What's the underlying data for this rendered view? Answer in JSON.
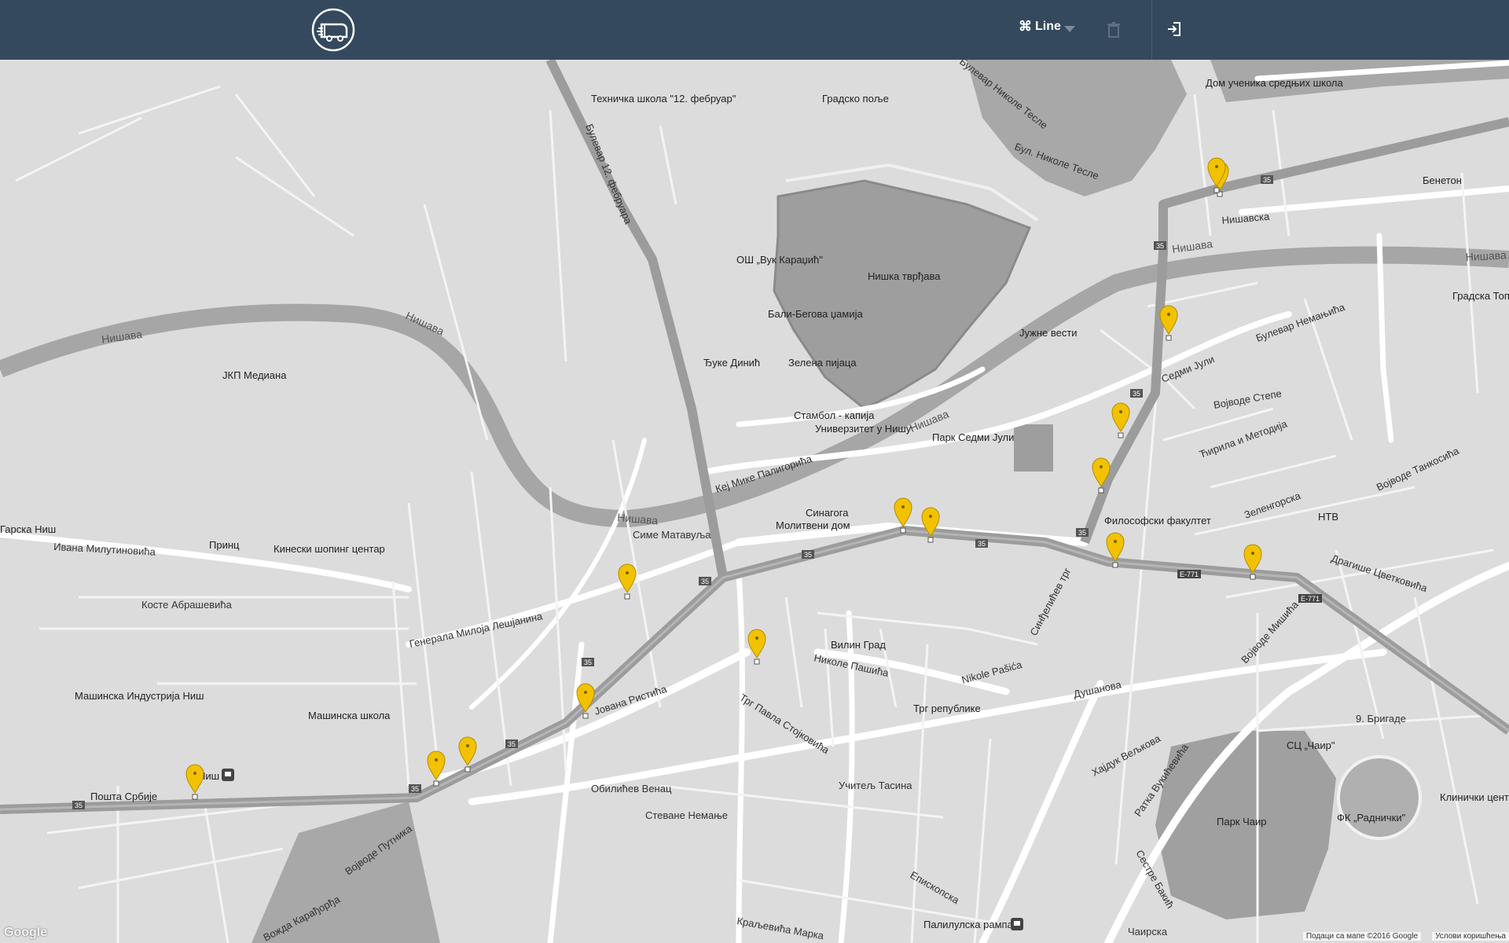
{
  "header": {
    "line_label": "Line",
    "line_icon": "command-icon",
    "trash_icon": "trash-icon",
    "login_icon": "sign-in-icon",
    "bg_color": "#34495e"
  },
  "map": {
    "rivers": [
      "Нишава",
      "Нишава",
      "Нишава",
      "Нишава",
      "Нишава",
      "Нишава"
    ],
    "places": [
      "Техничка школа \"12. фебруар\"",
      "Градско поље",
      "Дом ученика средњих школа",
      "Бенетон",
      "ОШ „Вук Караџић\"",
      "Нишка тврђава",
      "Бали-Бегова џамија",
      "Ђуке Динић",
      "Зелена пијаца",
      "Јужне вести",
      "Стамбол - капија",
      "Универзитет у Нишу",
      "Парк Седми Јули",
      "ЈКП Медиана",
      "Синагога",
      "Молитвени дом",
      "Философски факултет",
      "НТВ",
      "Принц",
      "Кинески шопинг центар",
      "Машинска Индустрија Ниш",
      "Машинска школа",
      "Вилин Град",
      "Трг републике",
      "Пошта Србије",
      "Ниш",
      "СЦ „Чаир\"",
      "Парк Чаир",
      "ФК „Раднички\"",
      "Клинички центар Н",
      "Палилулска рампа",
      "Градска Топл",
      "Гарска Ниш"
    ],
    "streets": [
      "Булевар 12. фебруара",
      "Булевар Николе Тесле",
      "Бул. Николе Тесле",
      "Нишавска",
      "Булевар Немањића",
      "Седми Јули",
      "Војводе Степе",
      "Ћирила и Методија",
      "Зеленгорска",
      "Драгише Цветковића",
      "Војводе Танкосића",
      "Душанова",
      "9. Бригаде",
      "Генерала Милоја Лешјанина",
      "Ивана Милутиновића",
      "Косте Абрашевића",
      "Јована Ристића",
      "Николе Пашића",
      "Nikole Pašića",
      "Трг Павла Стојковића",
      "Обилићев Венац",
      "Стеване Немање",
      "Учитељ Тасина",
      "Хајдук Вељкова",
      "Ратка Вукићевића",
      "Сестре Бакић",
      "Кеј Мике Палигорића",
      "Симе Матавуља",
      "Синђелићев трг",
      "Војводе Мишића",
      "Војводе Путника",
      "Вожда Карађорђа",
      "Епископска",
      "Краљевића Марка",
      "Чаирска"
    ],
    "route_badges": [
      "35",
      "E-771"
    ],
    "stop_count": 15,
    "attribution": "Подаци са мапе ©2016 Google",
    "terms": "Услови коришћења",
    "google_logo": "Google"
  }
}
